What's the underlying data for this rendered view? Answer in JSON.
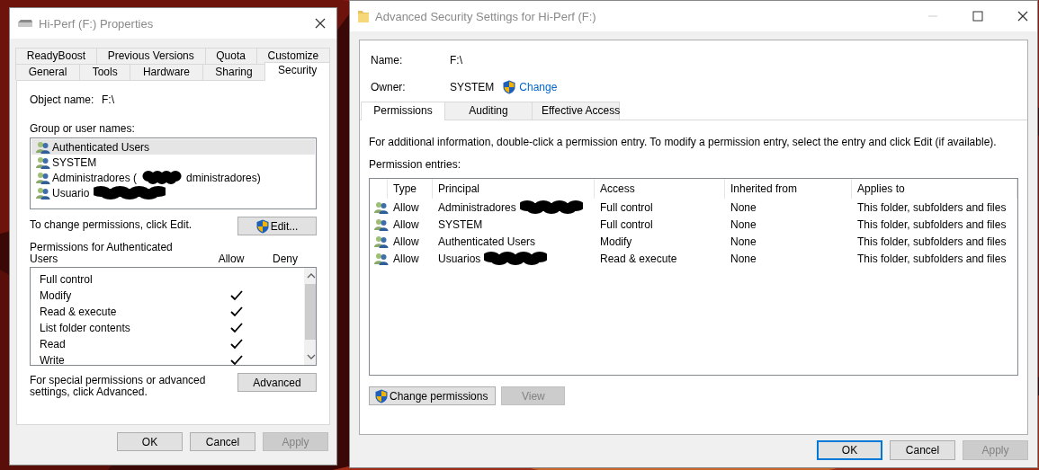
{
  "properties_window": {
    "title": "Hi-Perf (F:) Properties",
    "tab_rows": [
      [
        {
          "label": "ReadyBoost",
          "selected": false
        },
        {
          "label": "Previous Versions",
          "selected": false
        },
        {
          "label": "Quota",
          "selected": false
        },
        {
          "label": "Customize",
          "selected": false
        }
      ],
      [
        {
          "label": "General",
          "selected": false
        },
        {
          "label": "Tools",
          "selected": false
        },
        {
          "label": "Hardware",
          "selected": false
        },
        {
          "label": "Sharing",
          "selected": false
        },
        {
          "label": "Security",
          "selected": true
        }
      ]
    ],
    "object_name_label": "Object name:",
    "object_name": "F:\\",
    "groups_label": "Group or user names:",
    "groups": [
      {
        "name": "Authenticated Users",
        "selected": true,
        "redacted": false
      },
      {
        "name": "SYSTEM",
        "selected": false,
        "redacted": false
      },
      {
        "name": "Administradores (",
        "name_end": "dministradores)",
        "selected": false,
        "redacted": true
      },
      {
        "name": "Usuario",
        "selected": false,
        "redacted": true
      }
    ],
    "edit_hint": "To change permissions, click Edit.",
    "edit_button": "Edit...",
    "permissions_label": "Permissions for Authenticated Users",
    "allow_label": "Allow",
    "deny_label": "Deny",
    "permissions": [
      {
        "name": "Full control",
        "allow": false,
        "deny": false
      },
      {
        "name": "Modify",
        "allow": true,
        "deny": false
      },
      {
        "name": "Read & execute",
        "allow": true,
        "deny": false
      },
      {
        "name": "List folder contents",
        "allow": true,
        "deny": false
      },
      {
        "name": "Read",
        "allow": true,
        "deny": false
      },
      {
        "name": "Write",
        "allow": true,
        "deny": false
      }
    ],
    "advanced_hint": "For special permissions or advanced settings, click Advanced.",
    "advanced_button": "Advanced",
    "buttons": [
      {
        "label": "OK",
        "disabled": false,
        "default": false
      },
      {
        "label": "Cancel",
        "disabled": false,
        "default": false
      },
      {
        "label": "Apply",
        "disabled": true,
        "default": false
      }
    ]
  },
  "advanced_window": {
    "title": "Advanced Security Settings for Hi-Perf (F:)",
    "name_label": "Name:",
    "name": "F:\\",
    "owner_label": "Owner:",
    "owner": "SYSTEM",
    "change_link": "Change",
    "tabs": [
      {
        "label": "Permissions",
        "selected": true
      },
      {
        "label": "Auditing",
        "selected": false
      },
      {
        "label": "Effective Access",
        "selected": false
      }
    ],
    "info": "For additional information, double-click a permission entry. To modify a permission entry, select the entry and click Edit (if available).",
    "entries_label": "Permission entries:",
    "table": {
      "columns": [
        "Type",
        "Principal",
        "Access",
        "Inherited from",
        "Applies to"
      ],
      "rows": [
        {
          "type": "Allow",
          "principal": "Administradores",
          "redacted": true,
          "access": "Full control",
          "inherited_from": "None",
          "applies_to": "This folder, subfolders and files"
        },
        {
          "type": "Allow",
          "principal": "SYSTEM",
          "redacted": false,
          "access": "Full control",
          "inherited_from": "None",
          "applies_to": "This folder, subfolders and files"
        },
        {
          "type": "Allow",
          "principal": "Authenticated Users",
          "redacted": false,
          "access": "Modify",
          "inherited_from": "None",
          "applies_to": "This folder, subfolders and files"
        },
        {
          "type": "Allow",
          "principal": "Usuarios",
          "redacted": true,
          "access": "Read & execute",
          "inherited_from": "None",
          "applies_to": "This folder, subfolders and files"
        }
      ]
    },
    "change_permissions_button": {
      "label": "Change permissions",
      "disabled": false
    },
    "view_button": {
      "label": "View",
      "disabled": true
    },
    "buttons": [
      {
        "label": "OK",
        "disabled": false,
        "default": true
      },
      {
        "label": "Cancel",
        "disabled": false,
        "default": false
      },
      {
        "label": "Apply",
        "disabled": true,
        "default": false
      }
    ]
  }
}
